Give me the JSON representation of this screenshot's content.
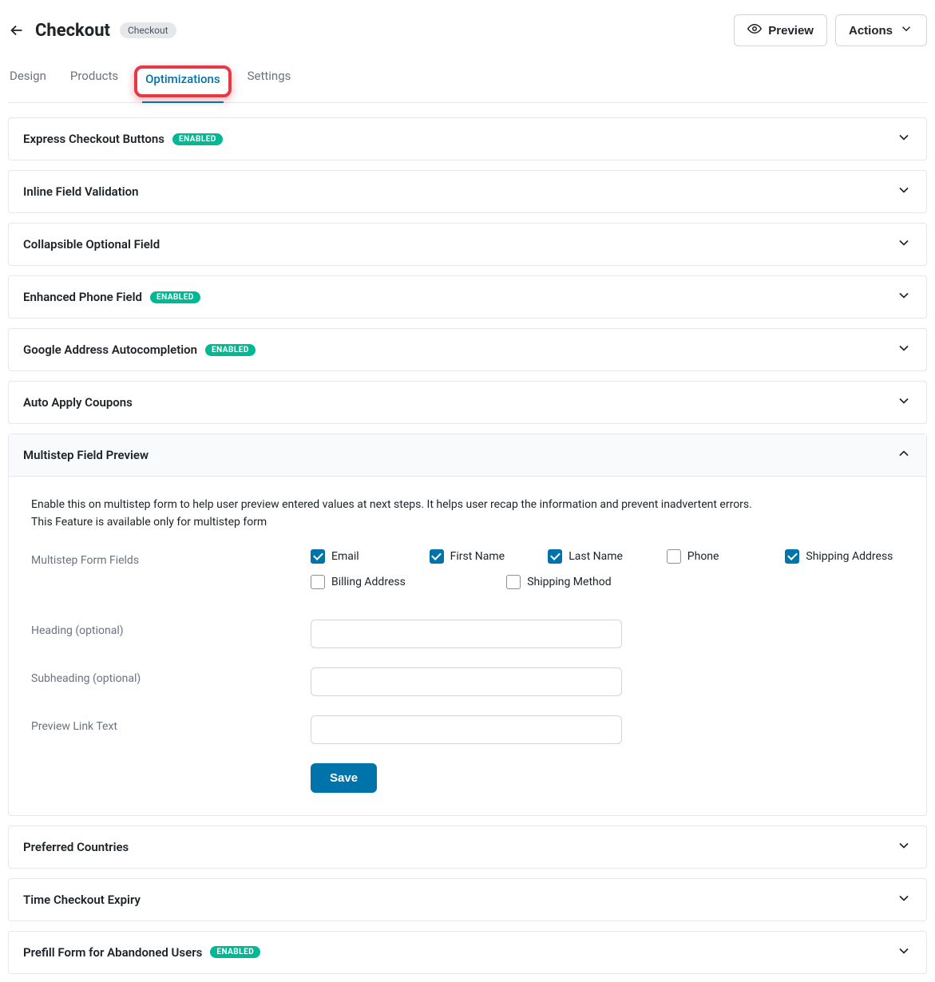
{
  "header": {
    "title": "Checkout",
    "badge": "Checkout",
    "preview_label": "Preview",
    "actions_label": "Actions"
  },
  "tabs": [
    "Design",
    "Products",
    "Optimizations",
    "Settings"
  ],
  "active_tab_index": 2,
  "enabled_badge": "ENABLED",
  "panels": [
    {
      "title": "Express Checkout Buttons",
      "enabled": true,
      "expanded": false
    },
    {
      "title": "Inline Field Validation",
      "enabled": false,
      "expanded": false
    },
    {
      "title": "Collapsible Optional Field",
      "enabled": false,
      "expanded": false
    },
    {
      "title": "Enhanced Phone Field",
      "enabled": true,
      "expanded": false
    },
    {
      "title": "Google Address Autocompletion",
      "enabled": true,
      "expanded": false
    },
    {
      "title": "Auto Apply Coupons",
      "enabled": false,
      "expanded": false
    },
    {
      "title": "Multistep Field Preview",
      "enabled": false,
      "expanded": true
    },
    {
      "title": "Preferred Countries",
      "enabled": false,
      "expanded": false
    },
    {
      "title": "Time Checkout Expiry",
      "enabled": false,
      "expanded": false
    },
    {
      "title": "Prefill Form for Abandoned Users",
      "enabled": true,
      "expanded": false
    }
  ],
  "multistep": {
    "description_line1": "Enable this on multistep form to help user preview entered values at next steps. It helps user recap the information and prevent inadvertent errors.",
    "description_line2": "This Feature is available only for multistep form",
    "fields_label": "Multistep Form Fields",
    "fields": [
      {
        "label": "Email",
        "checked": true
      },
      {
        "label": "First Name",
        "checked": true
      },
      {
        "label": "Last Name",
        "checked": true
      },
      {
        "label": "Phone",
        "checked": false
      },
      {
        "label": "Shipping Address",
        "checked": true
      },
      {
        "label": "Billing Address",
        "checked": false
      },
      {
        "label": "Shipping Method",
        "checked": false
      }
    ],
    "heading_label": "Heading (optional)",
    "heading_value": "",
    "subheading_label": "Subheading (optional)",
    "subheading_value": "",
    "linktext_label": "Preview Link Text",
    "linktext_value": "",
    "save_label": "Save"
  }
}
